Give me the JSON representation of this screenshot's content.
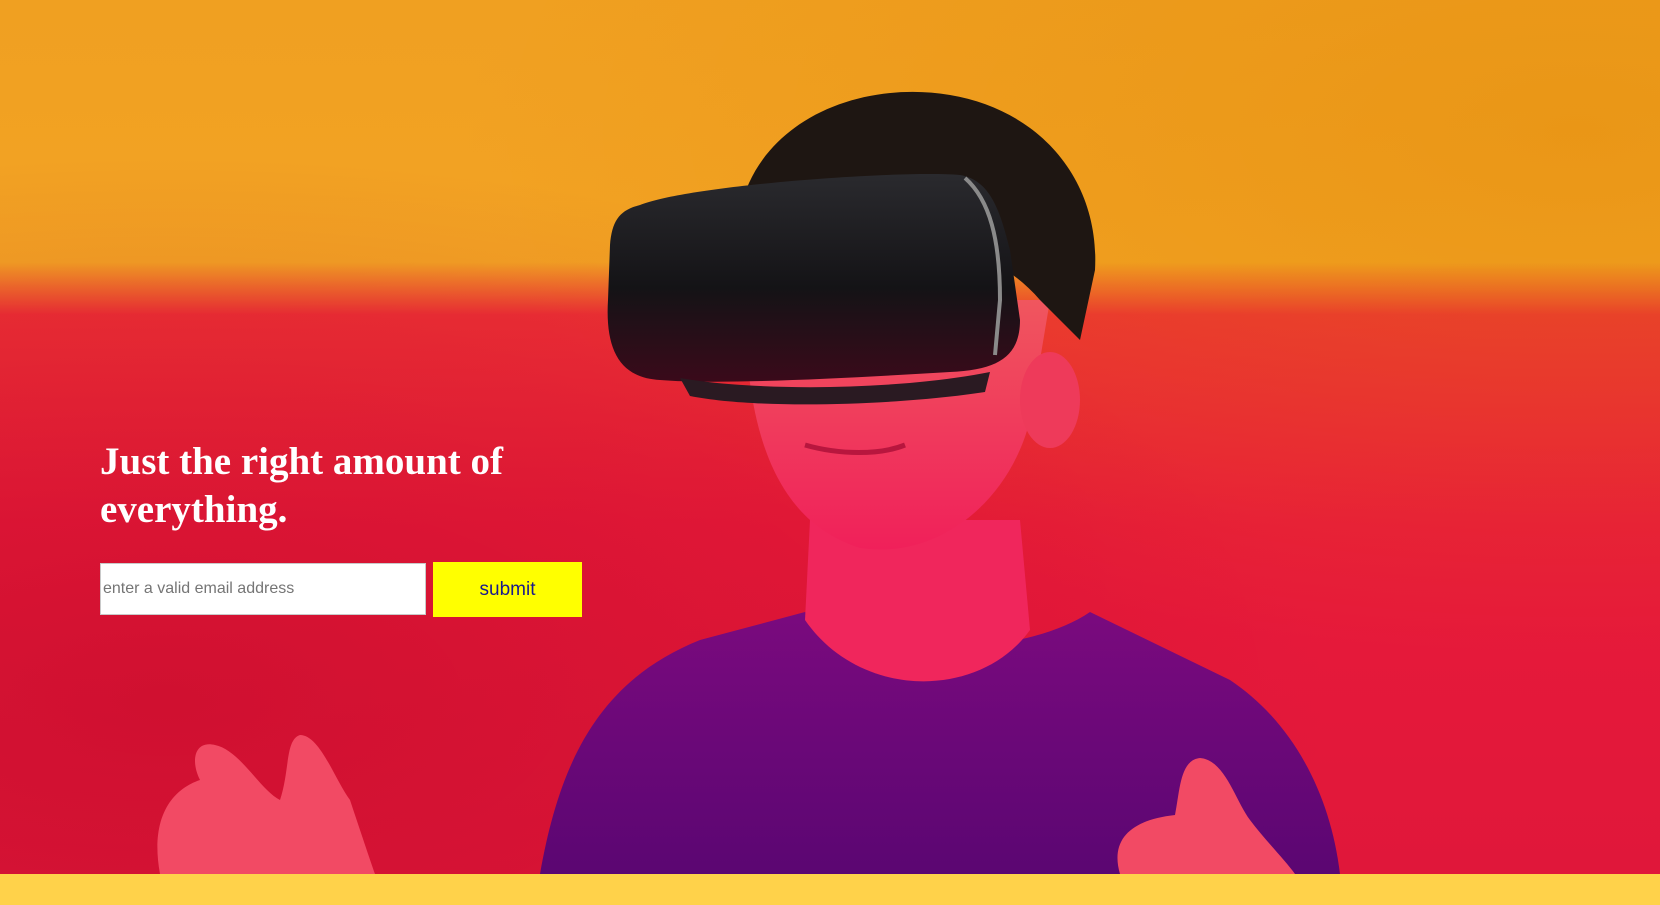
{
  "hero": {
    "headline": "Just the right amount of everything.",
    "image_subject": "person wearing a VR headset in front of an orange and red wall",
    "colors": {
      "wall_top": "#f3a324",
      "wall_bottom": "#e81a3a",
      "headset": "#1c1b1f",
      "skin_tint": "#f02a5c",
      "shirt": "#6a0878"
    }
  },
  "signup": {
    "email_placeholder": "enter a valid email address",
    "email_value": "",
    "submit_label": "submit",
    "submit_color": "#ffff00"
  },
  "footer": {
    "band_color": "#ffd24a"
  }
}
